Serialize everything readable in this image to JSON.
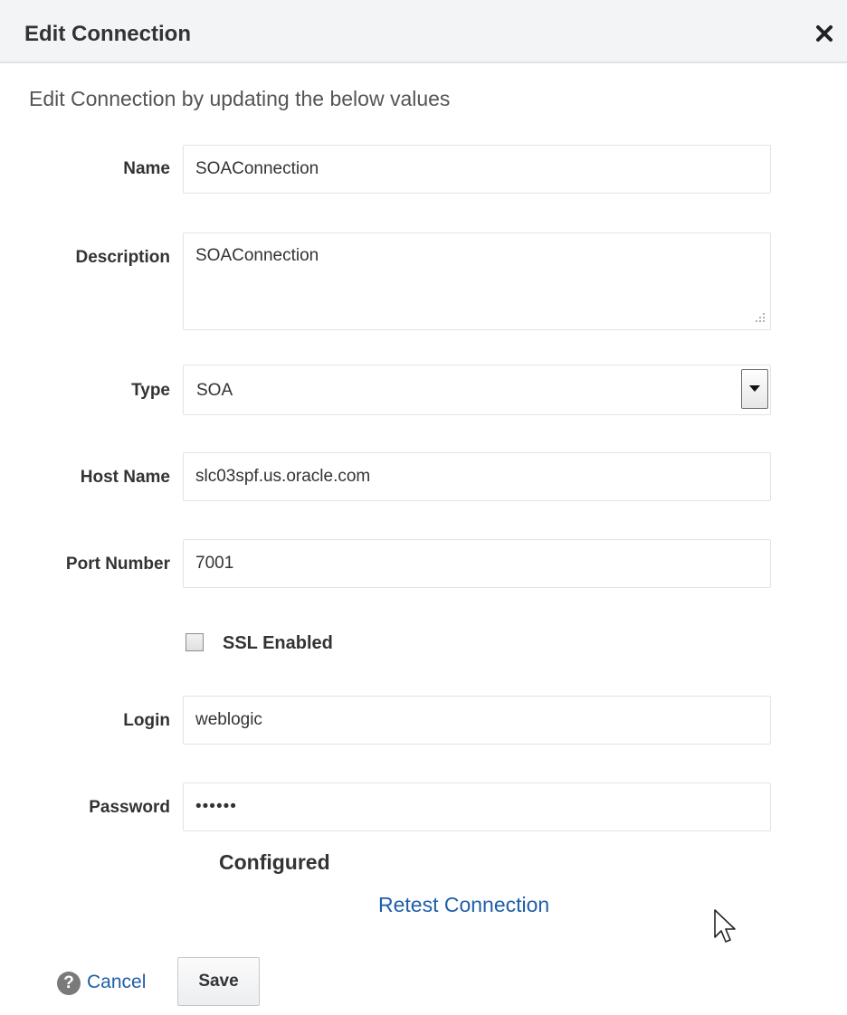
{
  "dialog": {
    "title": "Edit Connection",
    "subtitle": "Edit Connection by updating the below values"
  },
  "form": {
    "name": {
      "label": "Name",
      "value": "SOAConnection"
    },
    "description": {
      "label": "Description",
      "value": "SOAConnection"
    },
    "type": {
      "label": "Type",
      "value": "SOA"
    },
    "host_name": {
      "label": "Host Name",
      "value": "slc03spf.us.oracle.com"
    },
    "port_number": {
      "label": "Port Number",
      "value": "7001"
    },
    "ssl": {
      "label": "SSL Enabled",
      "checked": false
    },
    "login": {
      "label": "Login",
      "value": "weblogic"
    },
    "password": {
      "label": "Password",
      "value": "••••••"
    }
  },
  "status": {
    "text": "Configured",
    "retest_label": "Retest Connection"
  },
  "footer": {
    "help_glyph": "?",
    "cancel_label": "Cancel",
    "save_label": "Save"
  },
  "icons": {
    "close": "close-icon",
    "dropdown": "chevron-down-icon",
    "help": "help-icon",
    "cursor": "mouse-pointer-icon"
  },
  "colors": {
    "link": "#1f5fa8",
    "header_bg": "#f3f4f5",
    "field_border": "#dfe4e7"
  }
}
